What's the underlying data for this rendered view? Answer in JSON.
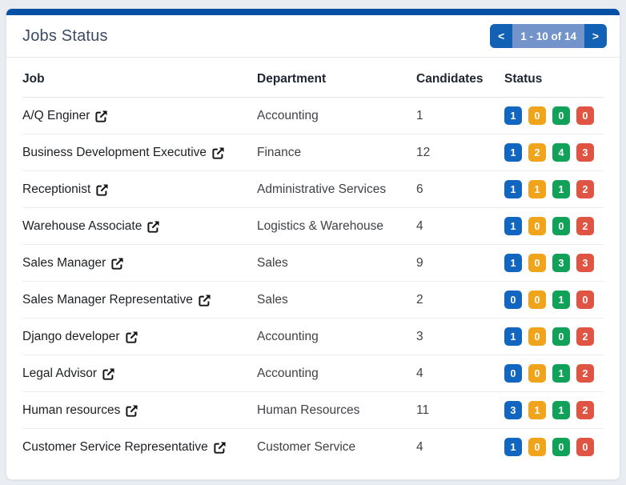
{
  "header": {
    "title": "Jobs Status",
    "pagination": {
      "prev": "<",
      "label": "1 - 10 of 14",
      "next": ">"
    }
  },
  "table": {
    "columns": [
      "Job",
      "Department",
      "Candidates",
      "Status"
    ],
    "rows": [
      {
        "job": "A/Q Enginer",
        "department": "Accounting",
        "candidates": "1",
        "status": [
          "1",
          "0",
          "0",
          "0"
        ]
      },
      {
        "job": "Business Development Executive",
        "department": "Finance",
        "candidates": "12",
        "status": [
          "1",
          "2",
          "4",
          "3"
        ]
      },
      {
        "job": "Receptionist",
        "department": "Administrative Services",
        "candidates": "6",
        "status": [
          "1",
          "1",
          "1",
          "2"
        ]
      },
      {
        "job": "Warehouse Associate",
        "department": "Logistics & Warehouse",
        "candidates": "4",
        "status": [
          "1",
          "0",
          "0",
          "2"
        ]
      },
      {
        "job": "Sales Manager",
        "department": "Sales",
        "candidates": "9",
        "status": [
          "1",
          "0",
          "3",
          "3"
        ]
      },
      {
        "job": "Sales Manager Representative",
        "department": "Sales",
        "candidates": "2",
        "status": [
          "0",
          "0",
          "1",
          "0"
        ]
      },
      {
        "job": "Django developer",
        "department": "Accounting",
        "candidates": "3",
        "status": [
          "1",
          "0",
          "0",
          "2"
        ]
      },
      {
        "job": "Legal Advisor",
        "department": "Accounting",
        "candidates": "4",
        "status": [
          "0",
          "0",
          "1",
          "2"
        ]
      },
      {
        "job": "Human resources",
        "department": "Human Resources",
        "candidates": "11",
        "status": [
          "3",
          "1",
          "1",
          "2"
        ]
      },
      {
        "job": "Customer Service Representative",
        "department": "Customer Service",
        "candidates": "4",
        "status": [
          "1",
          "0",
          "0",
          "0"
        ]
      }
    ]
  },
  "colors": {
    "accent_bar": "#0450a4",
    "pagination_button": "#1261b4",
    "pagination_label_bg": "#7394ca",
    "badge_colors": [
      "#1266c0",
      "#f0a41c",
      "#12a158",
      "#e05443"
    ]
  },
  "icons": {
    "external_link": "external-link-icon"
  }
}
